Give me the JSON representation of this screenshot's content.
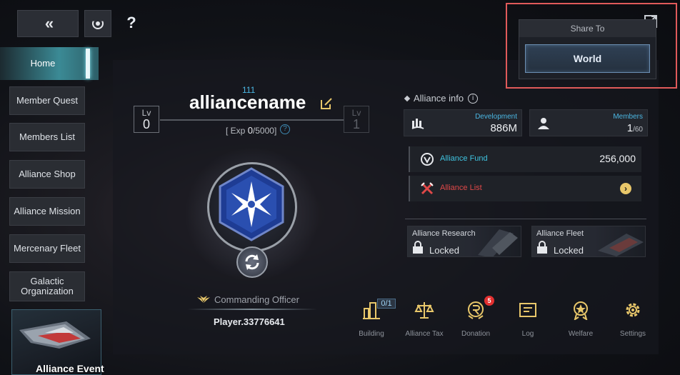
{
  "topbar": {
    "back_icon": "double-chevron-left-icon",
    "nebula_icon": "nebula-icon",
    "help_label": "?"
  },
  "sidebar": {
    "items": [
      {
        "label": "Home",
        "active": true
      },
      {
        "label": "Member Quest"
      },
      {
        "label": "Members List"
      },
      {
        "label": "Alliance Shop"
      },
      {
        "label": "Alliance Mission"
      },
      {
        "label": "Mercenary Fleet"
      },
      {
        "label": "Galactic Organization"
      }
    ],
    "event_label": "Alliance Event"
  },
  "alliance": {
    "id": "111",
    "name": "alliancename",
    "level_label": "Lv",
    "current_level": "0",
    "next_level": "1",
    "exp_prefix": "[ Exp ",
    "exp_current": "0",
    "exp_max": "/5000]",
    "officer_title": "Commanding Officer",
    "officer_name": "Player.33776641"
  },
  "info": {
    "header": "Alliance info",
    "development_label": "Development",
    "development_value": "886M",
    "members_label": "Members",
    "members_current": "1",
    "members_max": "/60",
    "fund_label": "Alliance Fund",
    "fund_value": "256,000",
    "list_label": "Alliance List",
    "research_label": "Alliance Research",
    "research_state": "Locked",
    "fleet_label": "Alliance Fleet",
    "fleet_state": "Locked"
  },
  "toolbar": {
    "building": {
      "label": "Building",
      "badge": "0/1"
    },
    "tax": {
      "label": "Alliance Tax"
    },
    "donation": {
      "label": "Donation",
      "badge": "5"
    },
    "log": {
      "label": "Log"
    },
    "welfare": {
      "label": "Welfare"
    },
    "settings": {
      "label": "Settings"
    }
  },
  "share": {
    "title": "Share To",
    "world_label": "World"
  },
  "colors": {
    "accent_blue": "#4bb7e3",
    "alliance_list_red": "#e04848",
    "fund_teal": "#3fc4e0",
    "highlight_outline": "#e05a5a",
    "badge_red": "#e23030",
    "emblem_blue": "#2a4fb0"
  }
}
